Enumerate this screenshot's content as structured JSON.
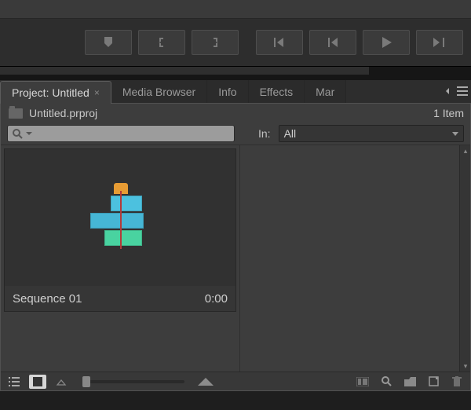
{
  "tabs": {
    "project": "Project: Untitled",
    "media_browser": "Media Browser",
    "info": "Info",
    "effects": "Effects",
    "markers_truncated": "Mar"
  },
  "project": {
    "filename": "Untitled.prproj",
    "item_count": "1 Item",
    "in_label": "In:",
    "filter_selected": "All"
  },
  "clip": {
    "name": "Sequence 01",
    "duration": "0:00"
  },
  "icons": {
    "search": "search-icon",
    "close_tab": "×"
  }
}
